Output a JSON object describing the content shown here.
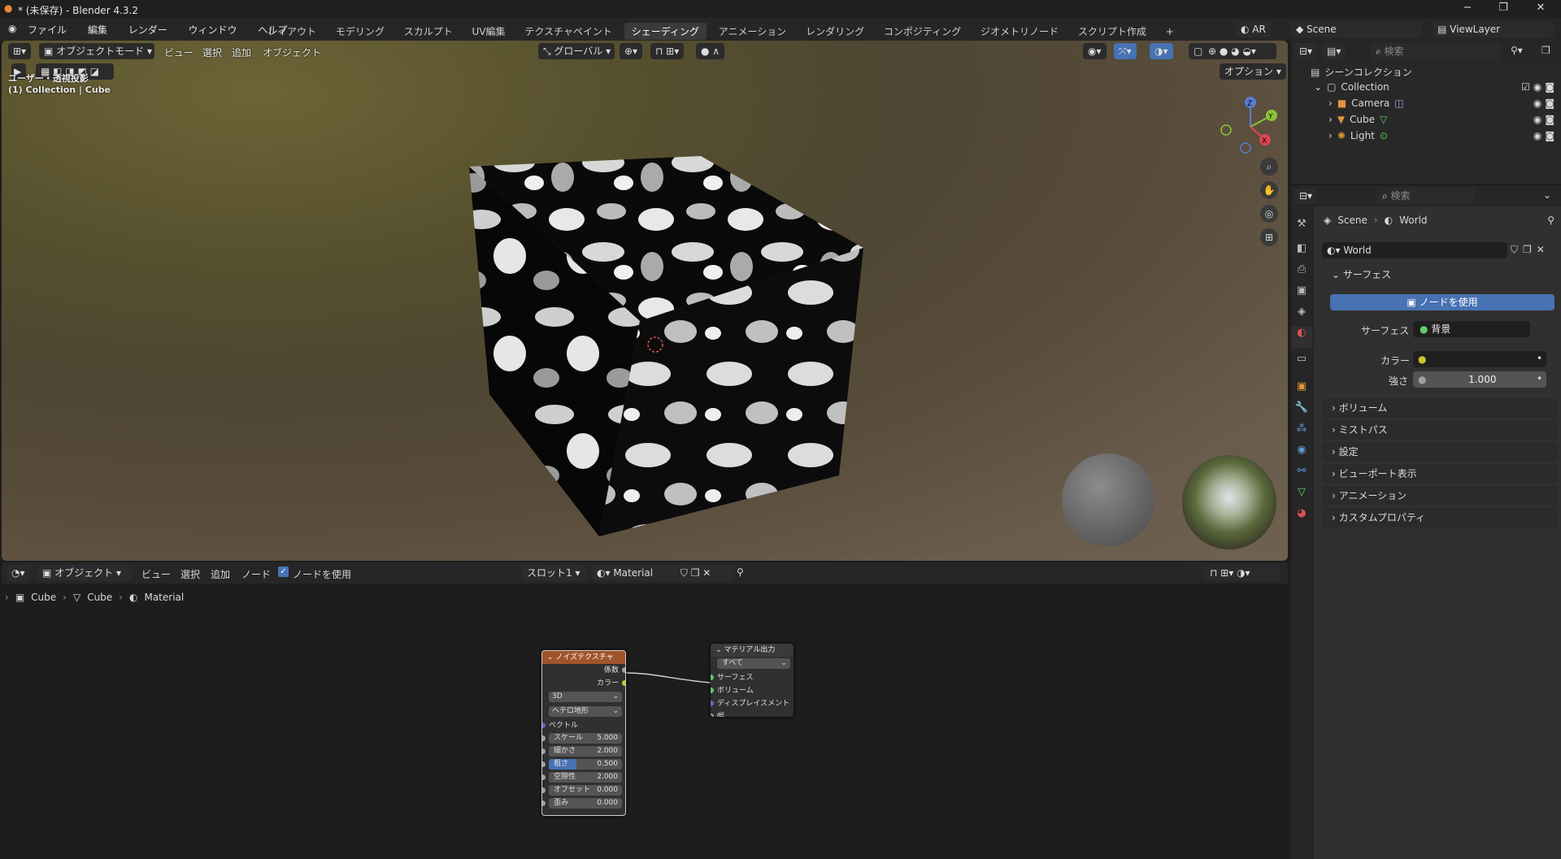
{
  "window": {
    "title": "* (未保存) - Blender 4.3.2",
    "minimize": "−",
    "restore": "❐",
    "close": "✕"
  },
  "menu": [
    "ファイル",
    "編集",
    "レンダー",
    "ウィンドウ",
    "ヘルプ"
  ],
  "workspaces": [
    "レイアウト",
    "モデリング",
    "スカルプト",
    "UV編集",
    "テクスチャペイント",
    "シェーディング",
    "アニメーション",
    "レンダリング",
    "コンポジティング",
    "ジオメトリノード",
    "スクリプト作成"
  ],
  "workspace_active": "シェーディング",
  "top_right": {
    "ar": "AR",
    "scene": "Scene",
    "view_layer": "ViewLayer"
  },
  "viewport": {
    "mode": "オブジェクトモード",
    "view": "ビュー",
    "select": "選択",
    "add": "追加",
    "object": "オブジェクト",
    "transform": "グローバル",
    "options": "オプション",
    "overlay_title": "ユーザー・透視投影",
    "overlay_sub": "(1) Collection | Cube",
    "gizmo": {
      "z": "Z",
      "y": "Y",
      "x": "X"
    }
  },
  "outliner": {
    "search_placeholder": "検索",
    "scene_collection": "シーンコレクション",
    "collection": "Collection",
    "items": [
      "Camera",
      "Cube",
      "Light"
    ]
  },
  "properties": {
    "search_placeholder": "検索",
    "breadcrumb": [
      "Scene",
      "World"
    ],
    "world_name": "World",
    "surface_section": "サーフェス",
    "use_nodes": "ノードを使用",
    "surface_label": "サーフェス",
    "surface_value": "背景",
    "color_label": "カラー",
    "strength_label": "強さ",
    "strength_value": "1.000",
    "sections": [
      "ボリューム",
      "ミストパス",
      "設定",
      "ビューポート表示",
      "アニメーション",
      "カスタムプロパティ"
    ]
  },
  "node_editor": {
    "object": "オブジェクト",
    "view": "ビュー",
    "select": "選択",
    "add": "追加",
    "node": "ノード",
    "use_nodes": "ノードを使用",
    "slot": "スロット1",
    "material": "Material",
    "breadcrumb": [
      "Cube",
      "Cube",
      "Material"
    ],
    "noise": {
      "title": "ノイズテクスチャ",
      "out_fac": "係数",
      "out_color": "カラー",
      "dim": "3D",
      "type": "ヘテロ地形",
      "vector": "ベクトル",
      "fields": [
        {
          "label": "スケール",
          "value": "5.000"
        },
        {
          "label": "細かさ",
          "value": "2.000"
        },
        {
          "label": "粗さ",
          "value": "0.500"
        },
        {
          "label": "空隙性",
          "value": "2.000"
        },
        {
          "label": "オフセット",
          "value": "0.000"
        },
        {
          "label": "歪み",
          "value": "0.000"
        }
      ]
    },
    "output": {
      "title": "マテリアル出力",
      "target": "すべて",
      "inputs": [
        "サーフェス",
        "ボリューム",
        "ディスプレイスメント",
        "幅"
      ]
    }
  },
  "colors": {
    "accent": "#4772b3",
    "noise_header": "#a0542a",
    "output_header": "#3a3a3a"
  }
}
